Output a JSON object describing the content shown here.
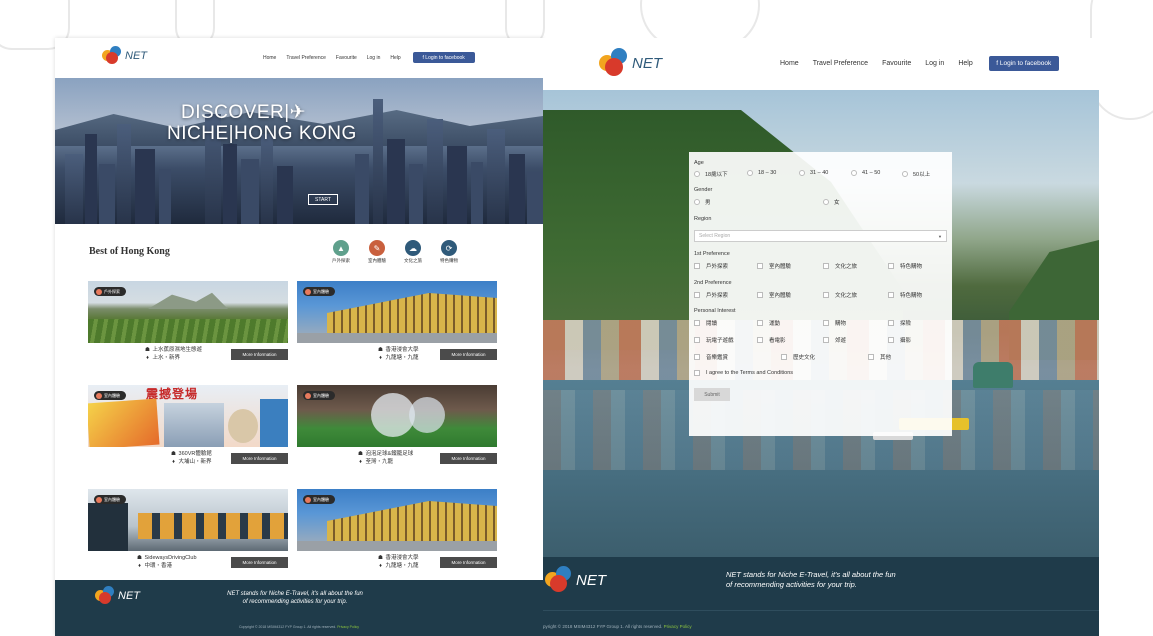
{
  "nav": {
    "brand": "NET",
    "links": [
      "Home",
      "Travel Preference",
      "Favourite",
      "Log in",
      "Help"
    ],
    "facebook_label": "f Login to facebook"
  },
  "hero": {
    "title_line1": "DISCOVER|✈",
    "title_line2": "NICHE|HONG KONG",
    "start_label": "START"
  },
  "best": {
    "title": "Best of Hong Kong",
    "categories": [
      {
        "label": "戶外探索",
        "icon": "hiking-icon",
        "color": "#5fa08c"
      },
      {
        "label": "室內體驗",
        "icon": "indoor-icon",
        "color": "#c9603e"
      },
      {
        "label": "文化之旅",
        "icon": "culture-icon",
        "color": "#2f5a7a"
      },
      {
        "label": "特色購物",
        "icon": "shopping-icon",
        "color": "#2f5a7a"
      }
    ]
  },
  "cards": [
    {
      "badge": "戶外探索",
      "name": "上水蕉原濕地生態遊",
      "location": "上水・新界",
      "more": "More Information"
    },
    {
      "badge": "室內體驗",
      "name": "香港浸會大學",
      "location": "九龍塘・九龍",
      "more": "More Information"
    },
    {
      "badge": "室內體驗",
      "name": "360VR體驗館",
      "location": "大埔山・新界",
      "more": "More Information"
    },
    {
      "badge": "室內體驗",
      "name": "泡泡足球&鐵籠足球",
      "location": "荃灣・九龍",
      "more": "More Information"
    },
    {
      "badge": "室內體驗",
      "name": "SidewaysDrivingClub",
      "location": "中環・香港",
      "more": "More Information"
    },
    {
      "badge": "室內體驗",
      "name": "香港浸會大學",
      "location": "九龍塘・九龍",
      "more": "More Information"
    }
  ],
  "card4_banner": "震撼登場",
  "footer": {
    "desc_line1": "NET stands for Niche E-Travel, it's all about the fun",
    "desc_line2": "of recommending activities for your trip.",
    "copyright_left": "Copyright © 2018 MSIM4312 FYP Group 1. All rights reserved.",
    "copyright_right": "pyright © 2018 MSIM4312 FYP Group 1. All rights reserved.",
    "privacy": "Privacy Policy"
  },
  "form": {
    "age_label": "Age",
    "age_options": [
      "18歲以下",
      "18 – 30",
      "31 – 40",
      "41 – 50",
      "50以上"
    ],
    "gender_label": "Gender",
    "gender_options": [
      "男",
      "女"
    ],
    "region_label": "Region",
    "region_placeholder": "Select Region",
    "pref1_label": "1st Preference",
    "pref2_label": "2nd Preference",
    "pref_options": [
      "戶外探索",
      "室內體驗",
      "文化之旅",
      "特色購物"
    ],
    "interest_label": "Personal Interest",
    "interest_row1": [
      "閱讀",
      "運動",
      "購物",
      "探險"
    ],
    "interest_row2": [
      "玩電子遊戲",
      "看電影",
      "郊遊",
      "攝影"
    ],
    "interest_row3": [
      "音樂鑑賞",
      "歷史文化",
      "其他"
    ],
    "terms": "I agree to the Terms and Conditions",
    "submit": "Submit"
  }
}
